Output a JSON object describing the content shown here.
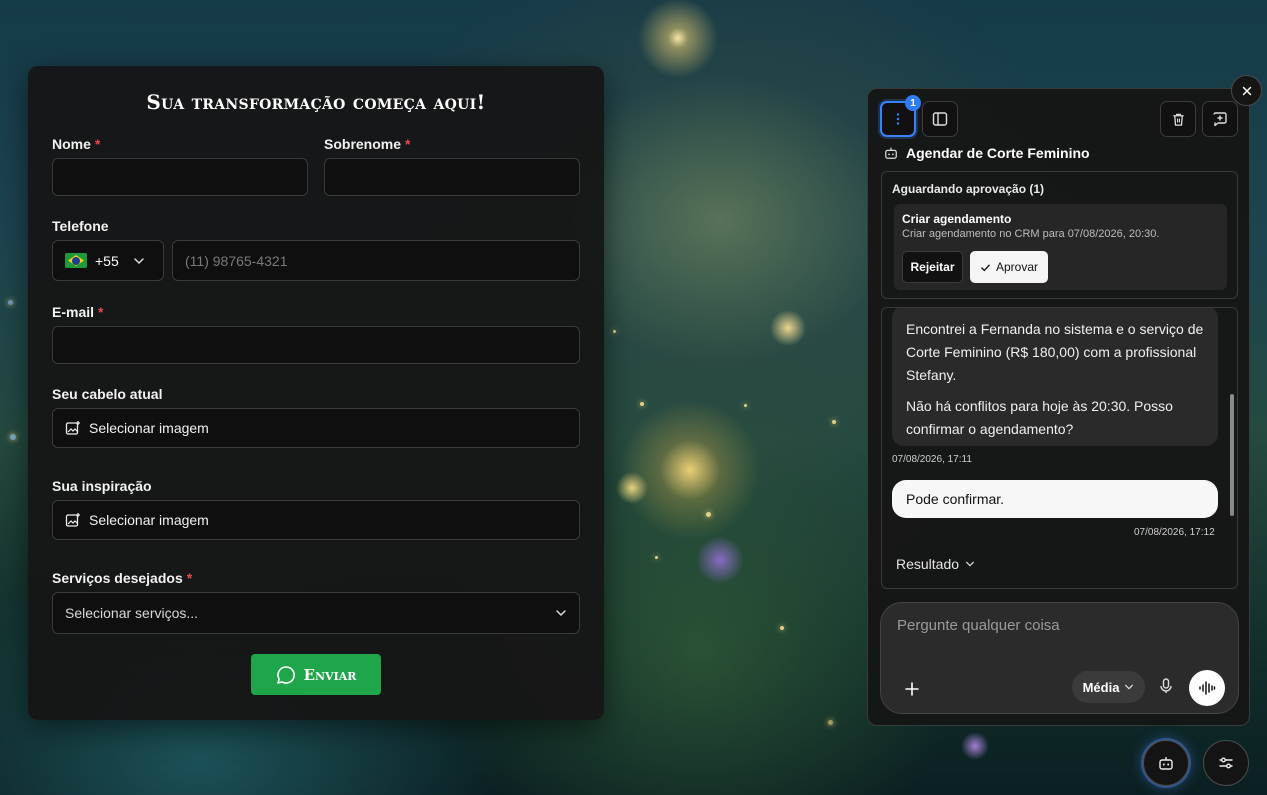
{
  "form": {
    "title": "Sua transformação começa aqui!",
    "first_name_label": "Nome",
    "last_name_label": "Sobrenome",
    "phone_label": "Telefone",
    "country_code": "+55",
    "phone_placeholder": "(11) 98765-4321",
    "email_label": "E-mail",
    "current_hair_label": "Seu cabelo atual",
    "inspiration_label": "Sua inspiração",
    "select_image_label": "Selecionar imagem",
    "services_label": "Serviços desejados",
    "services_placeholder": "Selecionar serviços...",
    "required_mark": "*",
    "submit_label": "Enviar"
  },
  "assistant": {
    "notification_count": "1",
    "agent_title": "Agendar de Corte Feminino",
    "approval": {
      "heading": "Aguardando aprovação (1)",
      "item_title": "Criar agendamento",
      "item_description": "Criar agendamento no CRM para 07/08/2026, 20:30.",
      "reject_label": "Rejeitar",
      "approve_label": "Aprovar"
    },
    "messages": [
      {
        "role": "agent",
        "paragraphs": [
          "Encontrei a Fernanda no sistema e o serviço de Corte Feminino (R$ 180,00) com a profissional Stefany.",
          "Não há conflitos para hoje às 20:30. Posso confirmar o agendamento?"
        ],
        "timestamp": "07/08/2026, 17:11"
      },
      {
        "role": "user",
        "text": "Pode confirmar.",
        "timestamp": "07/08/2026, 17:12"
      }
    ],
    "result_label": "Resultado",
    "composer_placeholder": "Pergunte qualquer coisa",
    "effort_label": "Média"
  },
  "colors": {
    "accent_blue": "#3b82f6",
    "send_green": "#1fa64a",
    "required_red": "#e5484d"
  },
  "icons": [
    "more-vertical-icon",
    "sidebar-icon",
    "trash-icon",
    "new-chat-icon",
    "close-icon",
    "robot-icon",
    "image-plus-icon",
    "chevron-down-icon",
    "whatsapp-icon",
    "check-icon",
    "plus-icon",
    "mic-icon",
    "voice-wave-icon",
    "settings-sliders-icon"
  ]
}
